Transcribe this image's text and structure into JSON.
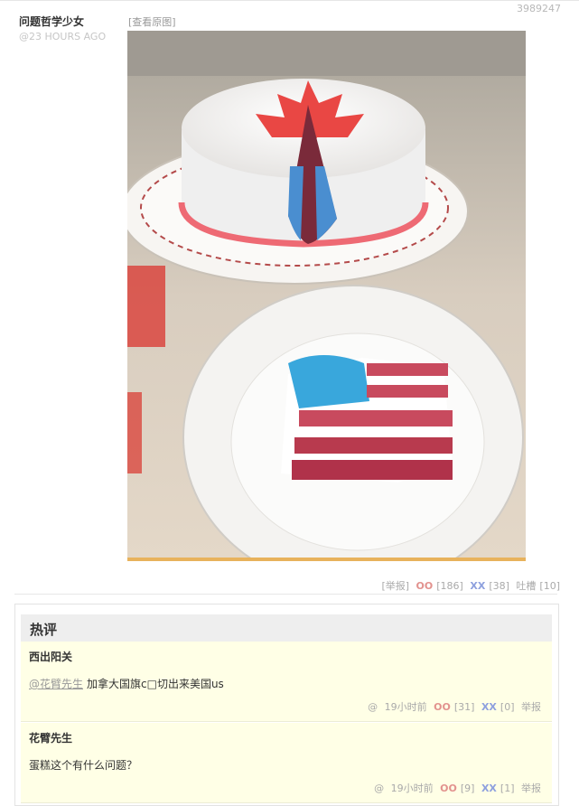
{
  "post": {
    "id": "3989247",
    "author": "问题哲学少女",
    "time": "@23 HOURS AGO",
    "view_original": "[查看原图]",
    "actions": {
      "report": "[举报]",
      "oo_label": "OO",
      "oo_count": "[186]",
      "xx_label": "XX",
      "xx_count": "[38]",
      "tucao_label": "吐槽",
      "tucao_count": "[10]"
    }
  },
  "hot_comments": {
    "title": "热评",
    "items": [
      {
        "name": "西出阳关",
        "mention": "@花臂先生",
        "text": "加拿大国旗c□切出来美国us",
        "at": "@",
        "time": "19小时前",
        "oo_label": "OO",
        "oo_count": "[31]",
        "xx_label": "XX",
        "xx_count": "[0]",
        "report": "举报"
      },
      {
        "name": "花臂先生",
        "text": "蛋糕这个有什么问题？",
        "at": "@",
        "time": "19小时前",
        "oo_label": "OO",
        "oo_count": "[9]",
        "xx_label": "XX",
        "xx_count": "[1]",
        "report": "举报"
      }
    ]
  }
}
